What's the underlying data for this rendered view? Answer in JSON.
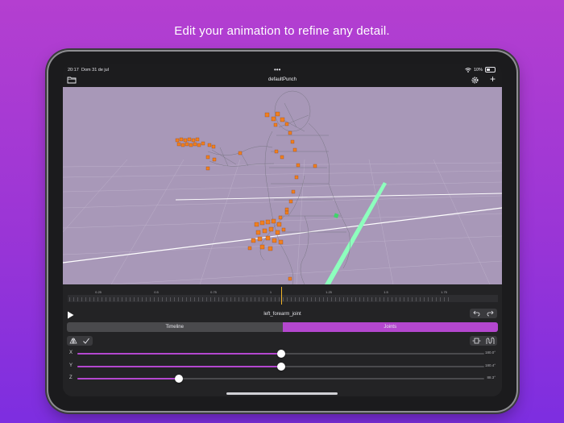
{
  "headline": "Edit your animation to refine any detail.",
  "status_bar": {
    "time": "20:17",
    "date": "Dom 31 de jul",
    "battery": "10%"
  },
  "nav": {
    "title": "defaultPunch",
    "folder_icon": "folder-icon",
    "settings_icon": "gear-icon",
    "add_label": "+"
  },
  "timeline": {
    "ticks": [
      "0.25",
      "0.5",
      "0.75",
      "1",
      "1.25",
      "1.5",
      "1.75"
    ],
    "playhead_time": 1.04
  },
  "joint_name": "left_forearm_joint",
  "tabs": {
    "timeline": "Timeline",
    "joints": "Joints",
    "selected": "joints"
  },
  "sliders": [
    {
      "axis": "X",
      "value": "180.0°",
      "fraction": 0.5
    },
    {
      "axis": "Y",
      "value": "180.4°",
      "fraction": 0.5
    },
    {
      "axis": "Z",
      "value": "88.3°",
      "fraction": 0.25
    }
  ],
  "colors": {
    "accent": "#b447cf",
    "playhead": "#f0b429",
    "viewport": "#a898b8",
    "joint": "#f07f20"
  }
}
